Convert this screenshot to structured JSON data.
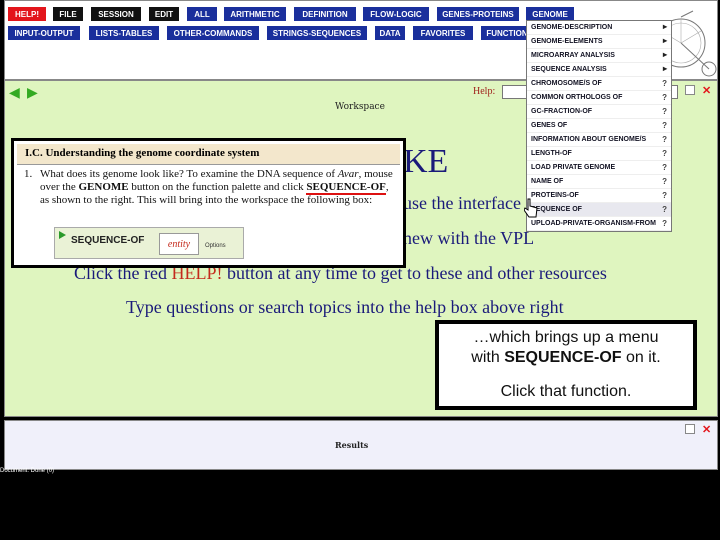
{
  "palette": {
    "row1": [
      {
        "label": "HELP!",
        "color": "red"
      },
      {
        "label": "FILE",
        "color": "black"
      },
      {
        "label": "SESSION",
        "color": "black"
      },
      {
        "label": "EDIT",
        "color": "black"
      },
      {
        "label": "ALL",
        "color": "blue"
      },
      {
        "label": "ARITHMETIC",
        "color": "blue"
      },
      {
        "label": "DEFINITION",
        "color": "blue"
      },
      {
        "label": "FLOW-LOGIC",
        "color": "blue"
      },
      {
        "label": "GENES-PROTEINS",
        "color": "blue"
      },
      {
        "label": "GENOME",
        "color": "blue"
      }
    ],
    "row2": [
      {
        "label": "INPUT-OUTPUT",
        "color": "blue"
      },
      {
        "label": "LISTS-TABLES",
        "color": "blue"
      },
      {
        "label": "OTHER-COMMANDS",
        "color": "blue"
      },
      {
        "label": "STRINGS-SEQUENCES",
        "color": "blue"
      },
      {
        "label": "DATA",
        "color": "blue"
      },
      {
        "label": "FAVORITES",
        "color": "blue"
      },
      {
        "label": "FUNCTION",
        "color": "blue"
      }
    ]
  },
  "workspace": {
    "title": "Workspace",
    "help_label": "Help:",
    "line1": "KE",
    "line2": "use the interface",
    "line3": "new with the VPL",
    "line4_pre": "Click the red ",
    "line4_red": "HELP!",
    "line4_post": " button at any time to get to these and other resources",
    "line5": "Type questions or search topics into the help box above right"
  },
  "results": {
    "title": "Results"
  },
  "instruction": {
    "header": "I.C. Understanding the genome coordinate system",
    "number": "1.",
    "text_a": "What does its genome look like? To examine the DNA sequence of ",
    "text_avar": "Avar",
    "text_b": ", mouse over the ",
    "text_genome": "GENOME",
    "text_c": " button on the function palette and click ",
    "text_seq": "SEQUENCE-OF",
    "text_d": ", as shown to the right. This will bring into the workspace the following box:",
    "widget_label": "SEQUENCE-OF",
    "widget_entity": "entity",
    "widget_options": "Options"
  },
  "genome_menu": [
    {
      "label": "GENOME-DESCRIPTION",
      "suffix": "▸"
    },
    {
      "label": "GENOME-ELEMENTS",
      "suffix": "▸"
    },
    {
      "label": "MICROARRAY ANALYSIS",
      "suffix": "▸"
    },
    {
      "label": "SEQUENCE ANALYSIS",
      "suffix": "▸"
    },
    {
      "label": "CHROMOSOME/S OF",
      "suffix": "?"
    },
    {
      "label": "COMMON ORTHOLOGS OF",
      "suffix": "?"
    },
    {
      "label": "GC-FRACTION-OF",
      "suffix": "?"
    },
    {
      "label": "GENES OF",
      "suffix": "?"
    },
    {
      "label": "INFORMATION ABOUT GENOME/S",
      "suffix": "?"
    },
    {
      "label": "LENGTH-OF",
      "suffix": "?"
    },
    {
      "label": "LOAD PRIVATE GENOME",
      "suffix": "?"
    },
    {
      "label": "NAME OF",
      "suffix": "?"
    },
    {
      "label": "PROTEINS-OF",
      "suffix": "?"
    },
    {
      "label": "SEQUENCE OF",
      "suffix": "?"
    },
    {
      "label": "UPLOAD-PRIVATE-ORGANISM-FROM",
      "suffix": "?"
    }
  ],
  "callout": {
    "line1": "…which brings up a menu",
    "line2_pre": "with ",
    "line2_bold": "SEQUENCE-OF",
    "line2_post": " on it.",
    "line3": "Click that function."
  },
  "status_text": "Document: Done (0)"
}
